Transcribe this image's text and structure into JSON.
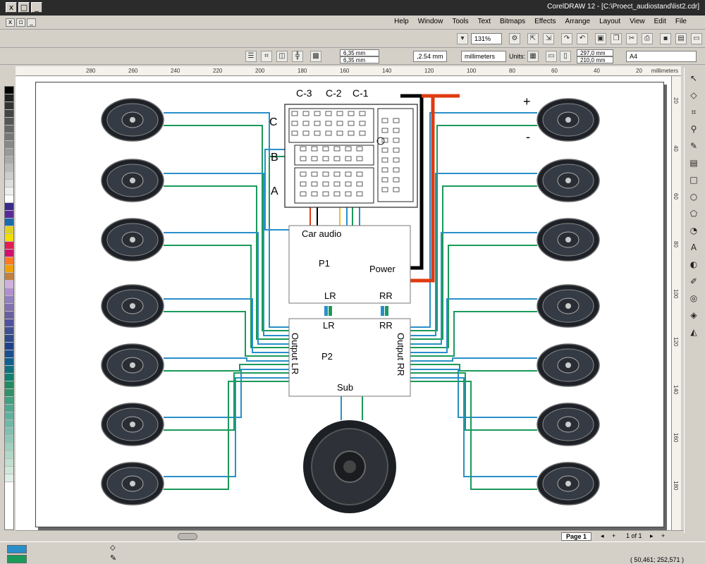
{
  "window": {
    "title": "CorelDRAW 12 - [C:\\Proect_audiostand\\list2.cdr]",
    "min_label": "_",
    "max_label": "□",
    "close_label": "x"
  },
  "menu": [
    "File",
    "Edit",
    "View",
    "Layout",
    "Arrange",
    "Effects",
    "Bitmaps",
    "Text",
    "Tools",
    "Window",
    "Help"
  ],
  "toolbar": {
    "zoom_value": "131%",
    "paper_size": "A4",
    "width_value": "297,0 mm",
    "height_value": "210,0 mm",
    "units_label": "Units:",
    "units_value": "millimeters",
    "nudge_value": ",2.54 mm",
    "duplicate_x": "6,35 mm",
    "duplicate_y": "6,35 mm"
  },
  "ruler": {
    "unit_label": "millimeters",
    "ticks": [
      "20",
      "40",
      "60",
      "80",
      "100",
      "120",
      "140",
      "160",
      "180",
      "200",
      "220",
      "240",
      "260",
      "280"
    ],
    "v_ticks": [
      "20",
      "40",
      "60",
      "80",
      "100",
      "120",
      "140",
      "160",
      "180"
    ]
  },
  "diagram": {
    "connector_row_labels": [
      "C",
      "B",
      "A"
    ],
    "connector_top_labels": [
      "C-1",
      "C-2",
      "C-3"
    ],
    "plus_label": "+",
    "minus_label": "-",
    "p1": {
      "name": "P1",
      "car_audio_label": "Car audio",
      "power_label": "Power",
      "lr_label": "LR",
      "rr_label": "RR"
    },
    "p2": {
      "name": "P2",
      "lr_label": "LR",
      "rr_label": "RR",
      "output_lr_label": "Output LR",
      "output_rr_label": "Output RR",
      "sub_label": "Sub"
    }
  },
  "pages": {
    "page_label": "Page 1",
    "count_label": "1 of 1"
  },
  "status": {
    "coords": "( 50,461; 252,571 )"
  },
  "colors": {
    "speaker_cone": "#353b45",
    "wire_blue": "#2a8fc9",
    "wire_green": "#1a9a5a",
    "wire_red": "#e03a10",
    "wire_black": "#000000",
    "wire_yellow": "#f0c020"
  }
}
